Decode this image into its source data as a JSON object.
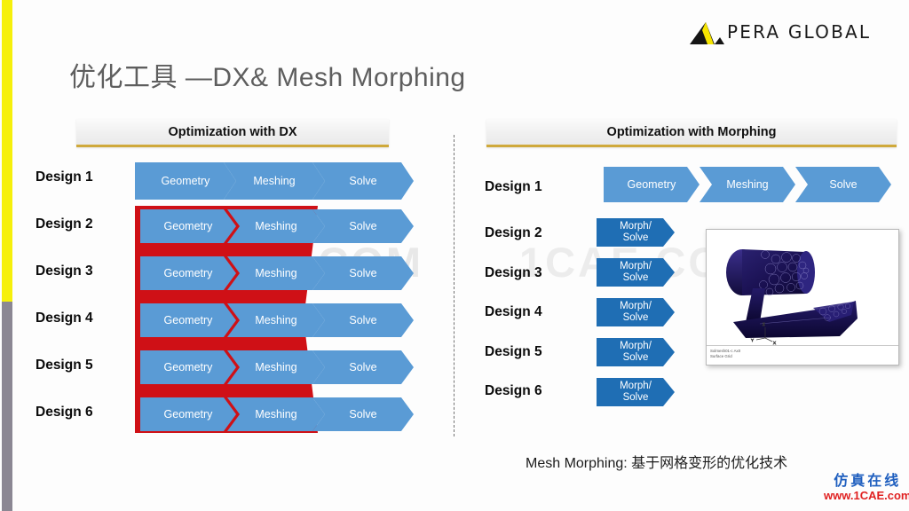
{
  "logo": {
    "text": "PERA GLOBAL",
    "mark": "triangle-mountain-icon",
    "colors": {
      "dark": "#1a1a1a",
      "accent": "#f5e400"
    }
  },
  "title": "优化工具 —DX& Mesh Morphing",
  "accents": {
    "left_stripe_yellow": "#f6f00c",
    "left_stripe_gray": "#8b8793",
    "chevron_blue": "#5a9bd5",
    "chevron_dark_blue": "#1f6eb4",
    "highlight_red": "#cf1016",
    "header_underline": "#cfa93b"
  },
  "panels": {
    "left": {
      "header": "Optimization with DX",
      "row_labels": [
        "Design 1",
        "Design 2",
        "Design 3",
        "Design 4",
        "Design 5",
        "Design 6"
      ],
      "steps": [
        "Geometry",
        "Meshing",
        "Solve"
      ],
      "rows": [
        {
          "label": "Design 1",
          "steps": [
            "Geometry",
            "Meshing",
            "Solve"
          ],
          "highlighted": false
        },
        {
          "label": "Design 2",
          "steps": [
            "Geometry",
            "Meshing",
            "Solve"
          ],
          "highlighted": true
        },
        {
          "label": "Design 3",
          "steps": [
            "Geometry",
            "Meshing",
            "Solve"
          ],
          "highlighted": true
        },
        {
          "label": "Design 4",
          "steps": [
            "Geometry",
            "Meshing",
            "Solve"
          ],
          "highlighted": true
        },
        {
          "label": "Design 5",
          "steps": [
            "Geometry",
            "Meshing",
            "Solve"
          ],
          "highlighted": true
        },
        {
          "label": "Design 6",
          "steps": [
            "Geometry",
            "Meshing",
            "Solve"
          ],
          "highlighted": true
        }
      ]
    },
    "right": {
      "header": "Optimization with Morphing",
      "rows": [
        {
          "label": "Design 1",
          "steps": [
            "Geometry",
            "Meshing",
            "Solve"
          ],
          "morph": false
        },
        {
          "label": "Design 2",
          "steps": [
            "Morph/\nSolve"
          ],
          "morph": true
        },
        {
          "label": "Design 3",
          "steps": [
            "Morph/\nSolve"
          ],
          "morph": true
        },
        {
          "label": "Design 4",
          "steps": [
            "Morph/\nSolve"
          ],
          "morph": true
        },
        {
          "label": "Design 5",
          "steps": [
            "Morph/\nSolve"
          ],
          "morph": true
        },
        {
          "label": "Design 6",
          "steps": [
            "Morph/\nSolve"
          ],
          "morph": true
        }
      ],
      "morph_label_line1": "Morph/",
      "morph_label_line2": "Solve"
    }
  },
  "thumbnail": {
    "alt": "cfd-surface-mesh-nacelle",
    "caption_line1": "Solmesh01-c  Ax0",
    "caption_line2": "Surface Grid",
    "axis_labels": {
      "z": "Z",
      "y": "Y",
      "x": "X"
    }
  },
  "caption": "Mesh Morphing: 基于网格变形的优化技术",
  "watermarks": {
    "center": "1CAE.COM",
    "center_part_a": "1CAE",
    "center_part_b": ".COM",
    "bottom_cn": "仿真在线",
    "bottom_url": "www.1CAE.com"
  }
}
